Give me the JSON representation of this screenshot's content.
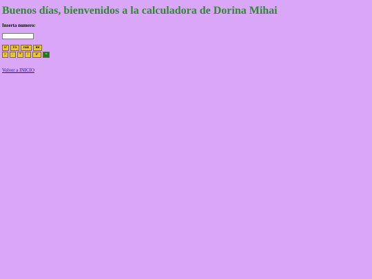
{
  "page": {
    "title": "Buenos días, bienvenidos a la calculadora de Dorina Mihai"
  },
  "form": {
    "input_label": "Inserta numero:",
    "input_value": ""
  },
  "buttons": {
    "row1": [
      {
        "label": "x²",
        "name": "square-button"
      },
      {
        "label": "1/x",
        "name": "reciprocal-button"
      },
      {
        "label": "raiz",
        "name": "sqrt-button"
      },
      {
        "label": "int",
        "name": "int-button"
      }
    ],
    "row2": [
      {
        "label": "+",
        "name": "add-button"
      },
      {
        "label": "-",
        "name": "subtract-button"
      },
      {
        "label": "*",
        "name": "multiply-button"
      },
      {
        "label": "/",
        "name": "divide-button"
      },
      {
        "label": "xʸ",
        "name": "power-button"
      },
      {
        "label": "=",
        "name": "equals-button"
      }
    ]
  },
  "footer": {
    "back_link": "Volver a INICIO"
  },
  "colors": {
    "background": "#d9a6f8",
    "title": "#2f8a2f",
    "button": "#e8c63a",
    "equals_button": "#1f7a1f",
    "link": "#1a0dab"
  }
}
